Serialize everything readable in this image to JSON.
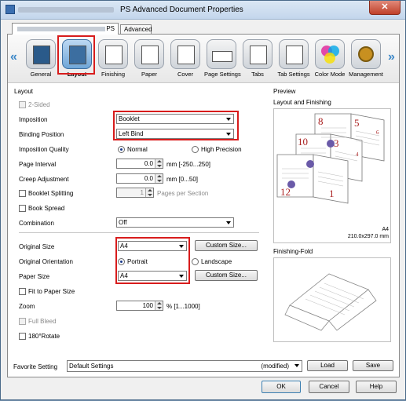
{
  "window": {
    "title": "PS Advanced Document Properties",
    "close_label": "✕"
  },
  "tabs": [
    {
      "label": "PS"
    },
    {
      "label": "Advanced"
    }
  ],
  "functions": [
    {
      "label": "General",
      "icon": "general-icon"
    },
    {
      "label": "Layout",
      "icon": "layout-icon",
      "selected": true
    },
    {
      "label": "Finishing",
      "icon": "finishing-icon"
    },
    {
      "label": "Paper",
      "icon": "paper-icon"
    },
    {
      "label": "Cover",
      "icon": "cover-icon"
    },
    {
      "label": "Page Settings",
      "icon": "page-settings-icon"
    },
    {
      "label": "Tabs",
      "icon": "tabs-icon"
    },
    {
      "label": "Tab Settings",
      "icon": "tab-settings-icon"
    },
    {
      "label": "Color Mode",
      "icon": "color-mode-icon"
    },
    {
      "label": "Management",
      "icon": "management-icon"
    }
  ],
  "layout": {
    "group_label": "Layout",
    "two_sided": "2-Sided",
    "imposition_label": "Imposition",
    "imposition_value": "Booklet",
    "binding_label": "Binding Position",
    "binding_value": "Left Bind",
    "quality_label": "Imposition Quality",
    "quality_normal": "Normal",
    "quality_high": "High Precision",
    "page_interval_label": "Page Interval",
    "page_interval_value": "0.0",
    "page_interval_unit": "mm [-250...250]",
    "creep_label": "Creep Adjustment",
    "creep_value": "0.0",
    "creep_unit": "mm [0...50]",
    "booklet_splitting": "Booklet Splitting",
    "pages_per_section_value": "1",
    "pages_per_section_label": "Pages per Section",
    "book_spread": "Book Spread",
    "combination_label": "Combination",
    "combination_value": "Off",
    "original_size_label": "Original Size",
    "original_size_value": "A4",
    "custom_size_1": "Custom Size...",
    "orientation_label": "Original Orientation",
    "orientation_portrait": "Portrait",
    "orientation_landscape": "Landscape",
    "paper_size_label": "Paper Size",
    "paper_size_value": "A4",
    "custom_size_2": "Custom Size...",
    "fit_to_paper": "Fit to Paper Size",
    "zoom_label": "Zoom",
    "zoom_value": "100",
    "zoom_unit": "% [1...1000]",
    "full_bleed": "Full Bleed",
    "rotate": "180°Rotate"
  },
  "preview": {
    "label": "Preview",
    "layout_finishing": "Layout and Finishing",
    "paper_info_1": "A4",
    "paper_info_2": "210.0x297.0 mm",
    "finishing_fold": "Finishing-Fold",
    "page_numbers": [
      "8",
      "5",
      "6",
      "10",
      "3",
      "4",
      "12",
      "1"
    ]
  },
  "bottom": {
    "favorite_label": "Favorite Setting",
    "favorite_value": "Default Settings",
    "modified": "(modified)",
    "load": "Load",
    "save": "Save",
    "ok": "OK",
    "cancel": "Cancel",
    "help": "Help"
  },
  "colors": {
    "highlight": "#d81c1c",
    "accent": "#3c88c8"
  }
}
